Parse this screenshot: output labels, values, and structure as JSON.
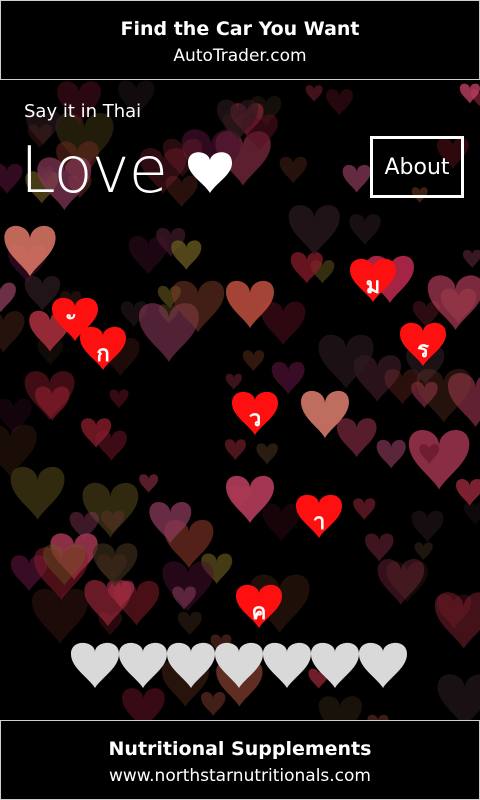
{
  "top_ad": {
    "title": "Find the Car You Want",
    "url": "AutoTrader.com"
  },
  "app": {
    "subtitle": "Say it in Thai",
    "title": "Love",
    "about_label": "About"
  },
  "letters": [
    "ม",
    "ั",
    "ร",
    "ก",
    "ว",
    "า",
    "ค"
  ],
  "answer_slots": 7,
  "colors": {
    "letter_heart": "#ff1010",
    "slot_heart": "#d9d9d9",
    "accent": "#ffffff"
  },
  "bottom_ad": {
    "title": "Nutritional Supplements",
    "url": "www.northstarnutritionals.com"
  }
}
